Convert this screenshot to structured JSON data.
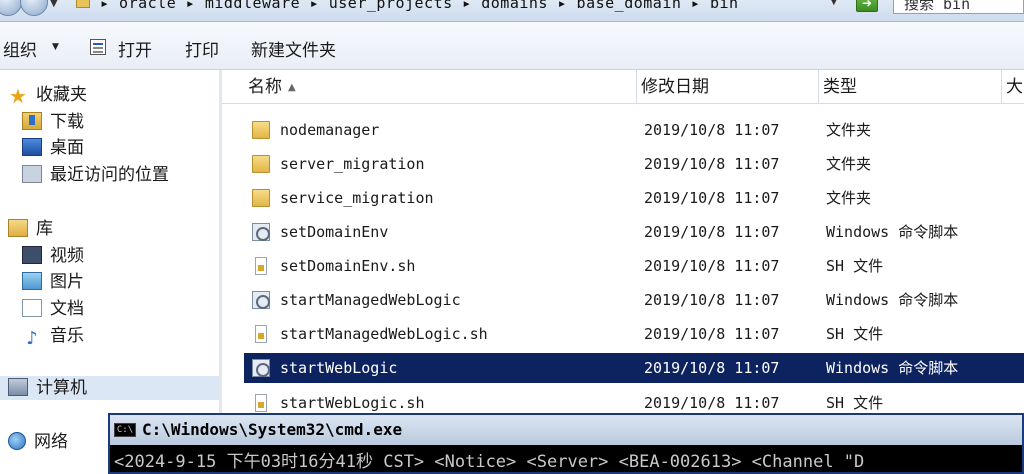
{
  "address_bar": {
    "path": "▸ oracle ▸ middleware ▸ user_projects ▸ domains ▸ base_domain ▸ bin",
    "search_placeholder": "搜索 bin"
  },
  "toolbar": {
    "organize": "组织",
    "open": "打开",
    "print": "打印",
    "new_folder": "新建文件夹"
  },
  "nav": {
    "favorites": "收藏夹",
    "downloads": "下载",
    "desktop": "桌面",
    "recent": "最近访问的位置",
    "libraries": "库",
    "videos": "视频",
    "pictures": "图片",
    "documents": "文档",
    "music": "音乐",
    "computer": "计算机",
    "network": "网络"
  },
  "columns": {
    "name": "名称",
    "date": "修改日期",
    "type": "类型",
    "size": "大"
  },
  "files": [
    {
      "name": "nodemanager",
      "date": "2019/10/8 11:07",
      "type": "文件夹",
      "icon": "folder-icon"
    },
    {
      "name": "server_migration",
      "date": "2019/10/8 11:07",
      "type": "文件夹",
      "icon": "folder-icon"
    },
    {
      "name": "service_migration",
      "date": "2019/10/8 11:07",
      "type": "文件夹",
      "icon": "folder-icon"
    },
    {
      "name": "setDomainEnv",
      "date": "2019/10/8 11:07",
      "type": "Windows 命令脚本",
      "icon": "batch-file-icon"
    },
    {
      "name": "setDomainEnv.sh",
      "date": "2019/10/8 11:07",
      "type": "SH 文件",
      "icon": "sh-file-icon"
    },
    {
      "name": "startManagedWebLogic",
      "date": "2019/10/8 11:07",
      "type": "Windows 命令脚本",
      "icon": "batch-file-icon"
    },
    {
      "name": "startManagedWebLogic.sh",
      "date": "2019/10/8 11:07",
      "type": "SH 文件",
      "icon": "sh-file-icon"
    },
    {
      "name": "startWebLogic",
      "date": "2019/10/8 11:07",
      "type": "Windows 命令脚本",
      "icon": "batch-file-icon"
    },
    {
      "name": "startWebLogic.sh",
      "date": "2019/10/8 11:07",
      "type": "SH 文件",
      "icon": "sh-file-icon"
    }
  ],
  "cmd": {
    "title": "C:\\Windows\\System32\\cmd.exe",
    "icon_text": "C:\\",
    "line": "<2024-9-15 下午03时16分41秒 CST> <Notice> <Server> <BEA-002613> <Channel \"D"
  },
  "colors": {
    "selection": "#0d2360",
    "folder": "#e2b548"
  }
}
